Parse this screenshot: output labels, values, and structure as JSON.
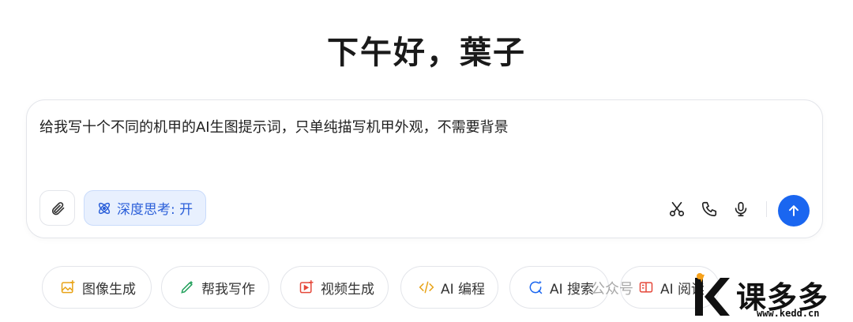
{
  "greeting": "下午好，葉子",
  "composer": {
    "prompt": "给我写十个不同的机甲的AI生图提示词，只单纯描写机甲外观，不需要背景",
    "deep_think_label": "深度思考: 开"
  },
  "chips": [
    {
      "label": "图像生成",
      "icon": "image-gen-icon"
    },
    {
      "label": "帮我写作",
      "icon": "pen-icon"
    },
    {
      "label": "视频生成",
      "icon": "video-icon"
    },
    {
      "label": "AI 编程",
      "icon": "code-icon"
    },
    {
      "label": "AI 搜索",
      "icon": "search-icon"
    },
    {
      "label": "AI 阅读",
      "icon": "book-icon"
    }
  ],
  "watermark": {
    "text": "公众号",
    "logo_name": "课多多",
    "logo_url": "www.kedd.cn"
  }
}
